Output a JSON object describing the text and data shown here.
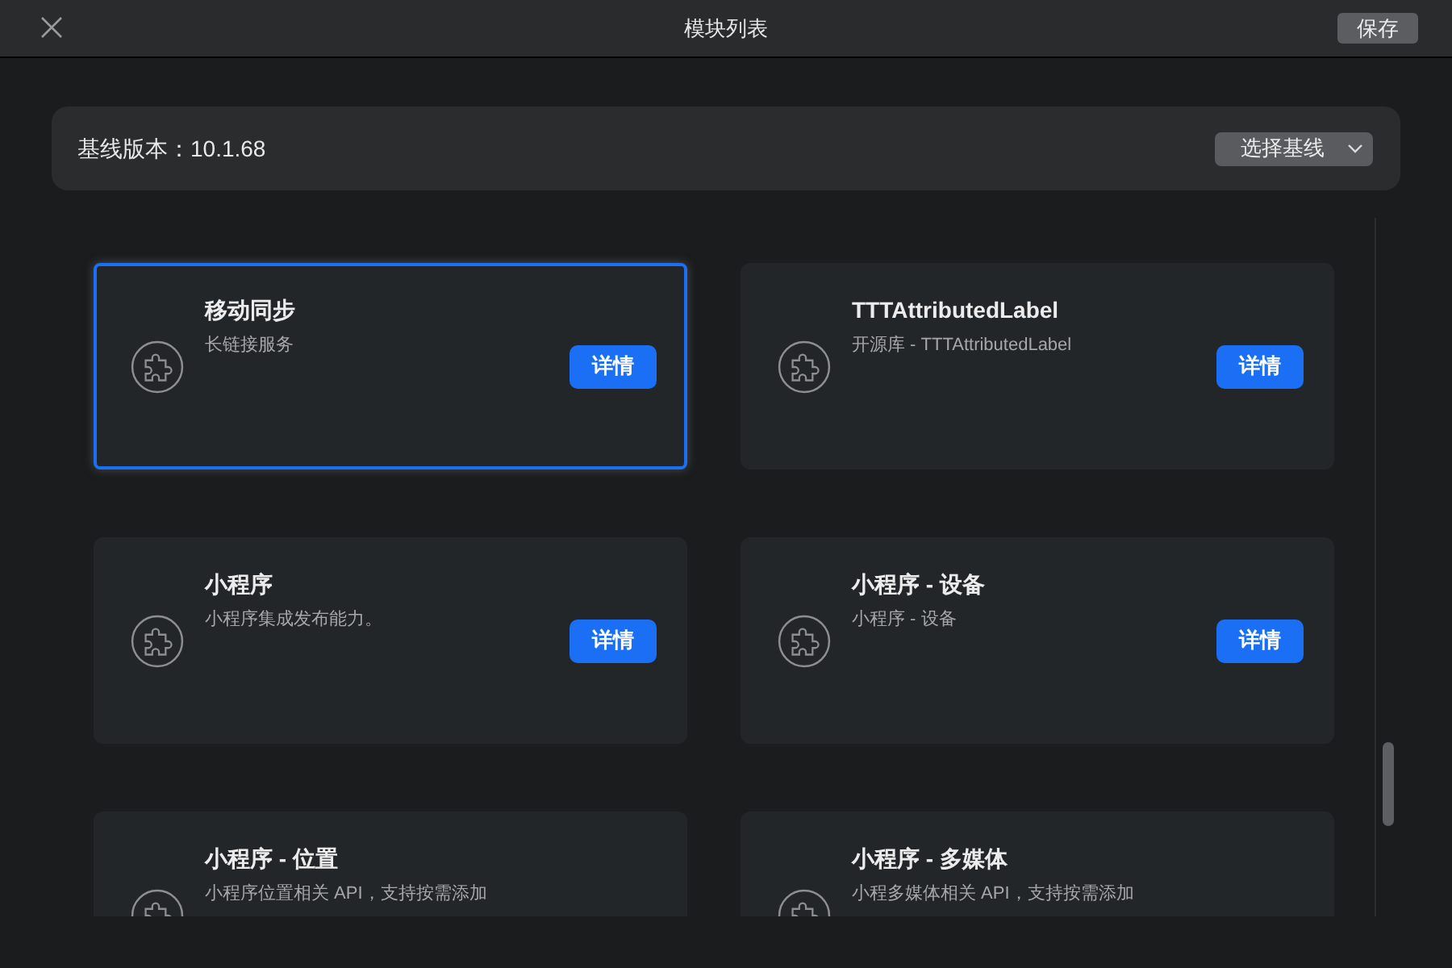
{
  "window": {
    "title": "模块列表",
    "save_button": "保存"
  },
  "baseline": {
    "label": "基线版本：10.1.68",
    "select_button": "选择基线"
  },
  "modules": [
    {
      "title": "移动同步",
      "description": "长链接服务",
      "button": "详情",
      "selected": true
    },
    {
      "title": "TTTAttributedLabel",
      "description": "开源库 - TTTAttributedLabel",
      "button": "详情",
      "selected": false
    },
    {
      "title": "小程序",
      "description": "小程序集成发布能力。",
      "button": "详情",
      "selected": false
    },
    {
      "title": "小程序 - 设备",
      "description": "小程序 - 设备",
      "button": "详情",
      "selected": false
    },
    {
      "title": "小程序 - 位置",
      "description": "小程序位置相关 API，支持按需添加",
      "selected": false
    },
    {
      "title": "小程序 - 多媒体",
      "description": "小程多媒体相关 API，支持按需添加",
      "selected": false
    }
  ]
}
